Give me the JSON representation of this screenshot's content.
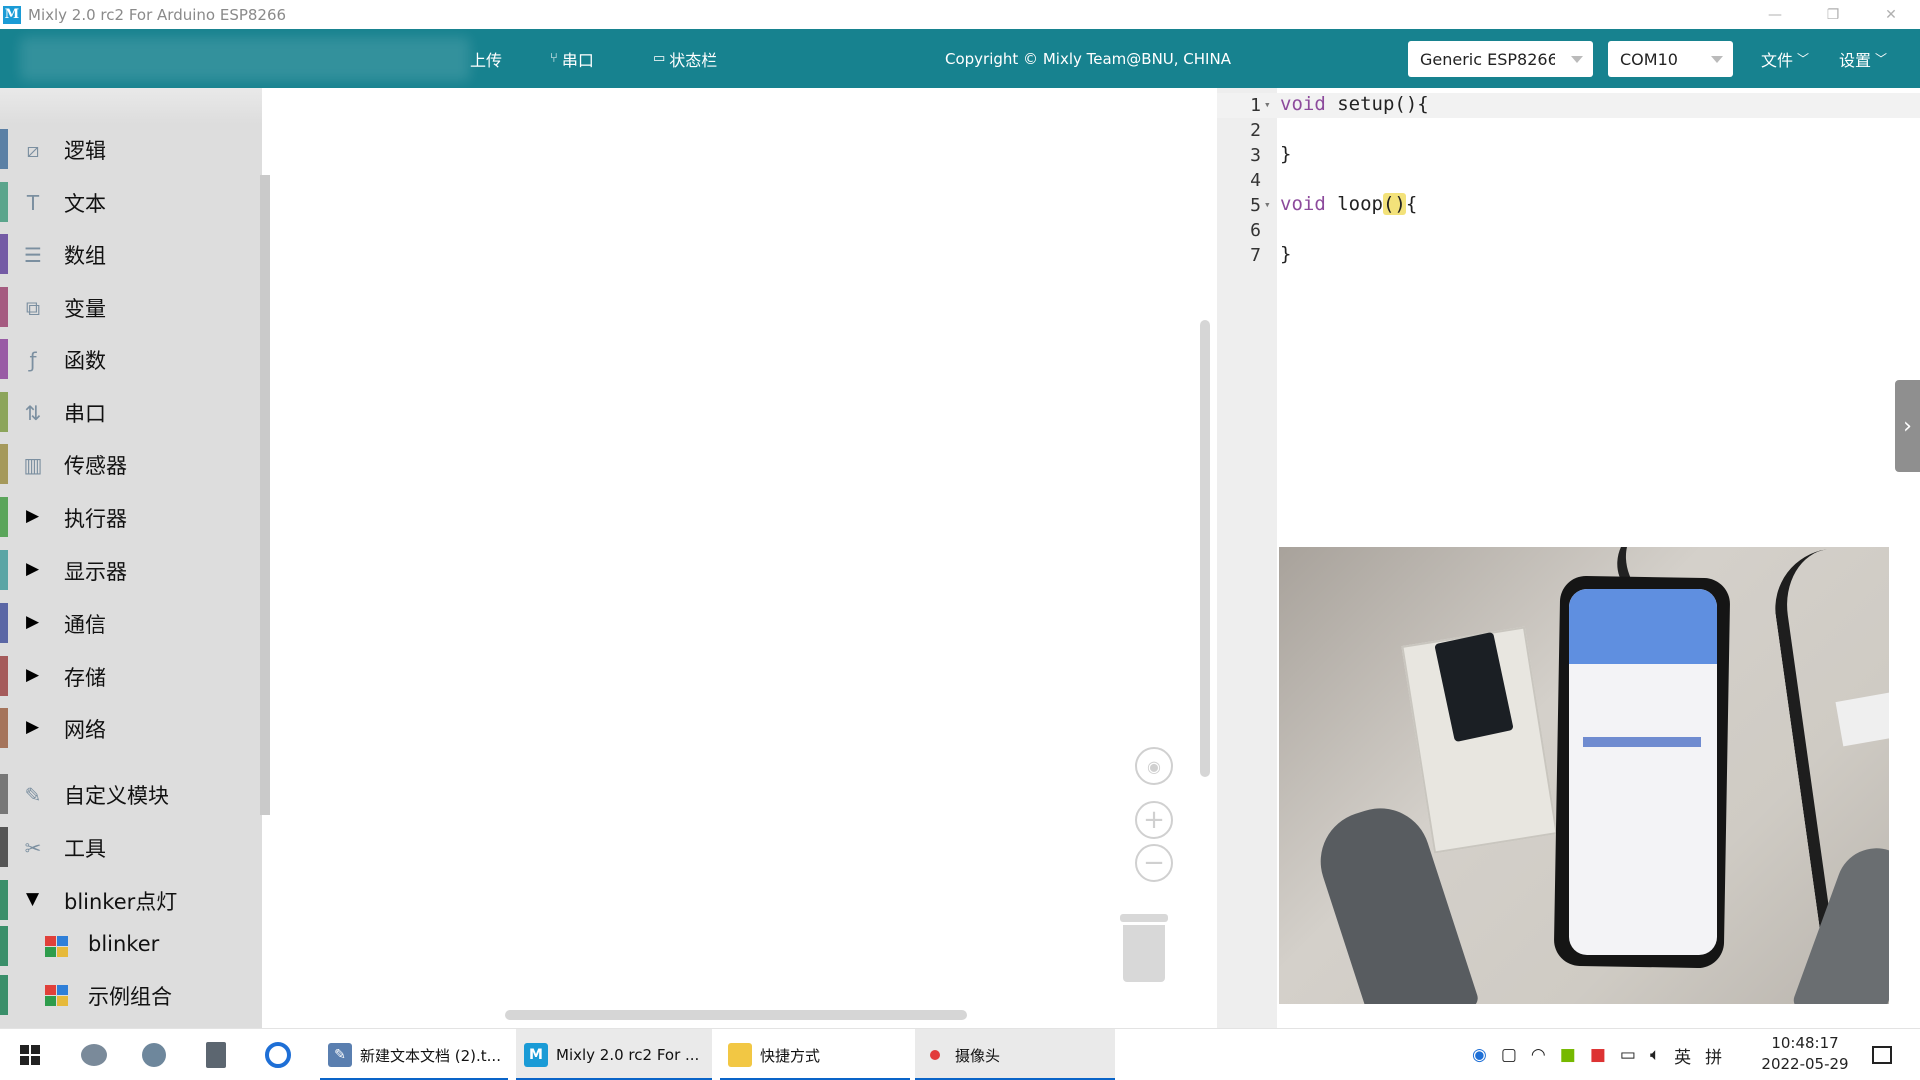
{
  "window": {
    "title": "Mixly 2.0 rc2 For Arduino ESP8266",
    "app_icon_letter": "M",
    "controls": [
      "—",
      "❐",
      "✕"
    ]
  },
  "toolbar": {
    "upload_label": "上传",
    "serial_label": "串口",
    "statusbar_label": "状态栏",
    "copyright": "Copyright © Mixly Team@BNU, CHINA",
    "board_select": "Generic ESP8266",
    "port_select": "COM10",
    "file_menu": "文件",
    "settings_menu": "设置",
    "accent_color": "#17828f"
  },
  "sidebar": {
    "categories": [
      {
        "label": "逻辑",
        "icon": "logic-icon",
        "color": "#5b80a5"
      },
      {
        "label": "文本",
        "icon": "text-icon",
        "color": "#5ba58c"
      },
      {
        "label": "数组",
        "icon": "list-icon",
        "color": "#745ba5"
      },
      {
        "label": "变量",
        "icon": "variable-icon",
        "color": "#a55b80"
      },
      {
        "label": "函数",
        "icon": "function-icon",
        "color": "#995ba5"
      },
      {
        "label": "串口",
        "icon": "serial-icon",
        "color": "#8ca55b"
      },
      {
        "label": "传感器",
        "icon": "sensor-icon",
        "color": "#a5995b"
      },
      {
        "label": "执行器",
        "icon": "expand-arrow",
        "color": "#5ba55b"
      },
      {
        "label": "显示器",
        "icon": "expand-arrow",
        "color": "#5ba5a5"
      },
      {
        "label": "通信",
        "icon": "expand-arrow",
        "color": "#5b67a5"
      },
      {
        "label": "存储",
        "icon": "expand-arrow",
        "color": "#a55b5b"
      },
      {
        "label": "网络",
        "icon": "expand-arrow",
        "color": "#a5745b"
      },
      {
        "label": "自定义模块",
        "icon": "custom-icon",
        "color": "#777777"
      },
      {
        "label": "工具",
        "icon": "tools-icon",
        "color": "#555555"
      },
      {
        "label": "blinker点灯",
        "icon": "collapse-arrow",
        "color": "#3a8f6a"
      }
    ],
    "subitems": [
      {
        "label": "blinker"
      },
      {
        "label": "示例组合"
      }
    ]
  },
  "editor": {
    "lines": [
      {
        "num": "1",
        "fold": "▾",
        "kw": "void",
        "rest": " setup(){",
        "active": true
      },
      {
        "num": "2",
        "fold": "",
        "kw": "",
        "rest": ""
      },
      {
        "num": "3",
        "fold": "",
        "kw": "",
        "rest": "}"
      },
      {
        "num": "4",
        "fold": "",
        "kw": "",
        "rest": ""
      },
      {
        "num": "5",
        "fold": "▾",
        "kw": "void",
        "rest": " loop",
        "cursor": "()",
        "after": "{"
      },
      {
        "num": "6",
        "fold": "",
        "kw": "",
        "rest": ""
      },
      {
        "num": "7",
        "fold": "",
        "kw": "",
        "rest": "}"
      }
    ],
    "side_tab_icon": "chevron-right-icon"
  },
  "taskbar": {
    "tasks": [
      {
        "label": "新建文本文档 (2).t...",
        "icon": "notepad-icon"
      },
      {
        "label": "Mixly 2.0 rc2 For ...",
        "icon": "mixly-icon"
      },
      {
        "label": "快捷方式",
        "icon": "folder-icon"
      },
      {
        "label": "摄像头",
        "icon": "camera-icon"
      }
    ],
    "ime_lang": "英",
    "ime_mode": "拼",
    "time": "10:48:17",
    "date": "2022-05-29"
  }
}
